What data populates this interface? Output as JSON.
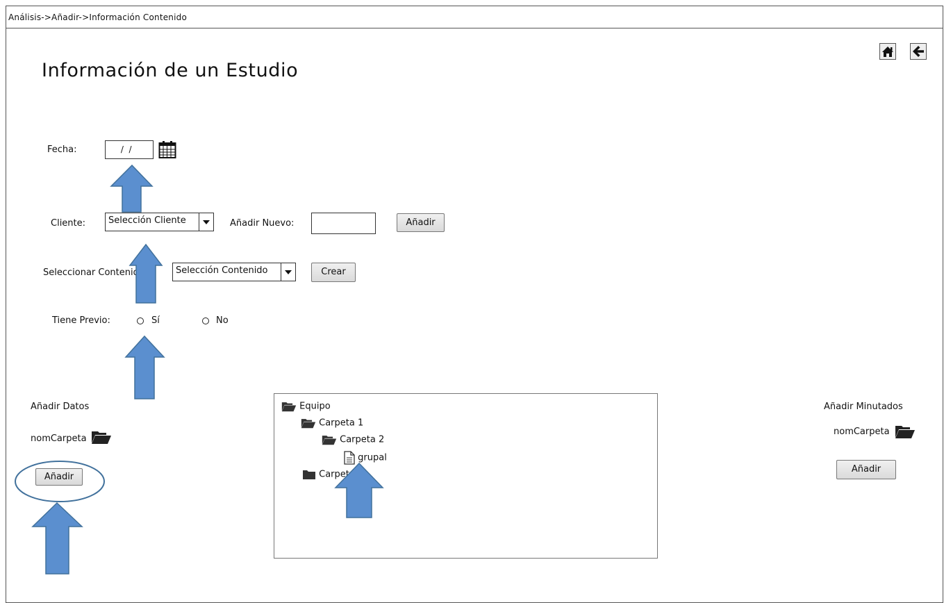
{
  "breadcrumb": "Análisis->Añadir->Información Contenido",
  "title": "Información de un Estudio",
  "nav": {
    "home_icon": "home-icon",
    "back_icon": "arrow-left-icon"
  },
  "fecha": {
    "label": "Fecha:",
    "value": " /  /",
    "calendar_icon": "calendar-icon"
  },
  "cliente": {
    "label": "Cliente:",
    "select_value": "Selección Cliente",
    "nuevo_label": "Añadir Nuevo:",
    "nuevo_value": "",
    "add_button": "Añadir"
  },
  "contenido": {
    "label": "Seleccionar Contenido",
    "select_value": "Selección Contenido",
    "create_button": "Crear"
  },
  "previo": {
    "label": "Tiene Previo:",
    "options": [
      "Sí",
      "No"
    ]
  },
  "datos": {
    "label": "Añadir Datos",
    "folder_name": "nomCarpeta",
    "add_button": "Añadir"
  },
  "minutados": {
    "label": "Añadir Minutados",
    "folder_name": "nomCarpeta",
    "add_button": "Añadir"
  },
  "tree": {
    "items": [
      {
        "label": "Equipo",
        "icon": "folder-open-icon"
      },
      {
        "label": "Carpeta 1",
        "icon": "folder-open-icon"
      },
      {
        "label": "Carpeta 2",
        "icon": "folder-open-icon"
      },
      {
        "label": "grupal",
        "icon": "file-icon"
      },
      {
        "label": "Carpeta",
        "icon": "folder-closed-icon"
      }
    ]
  },
  "annotation": {
    "color": "#5b8fcf",
    "outline_color": "#41719c"
  }
}
